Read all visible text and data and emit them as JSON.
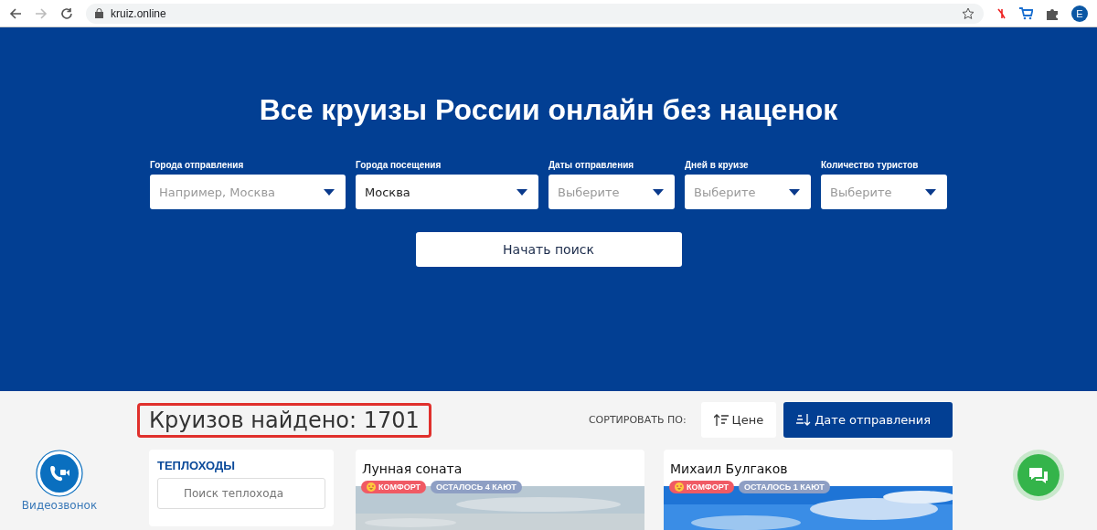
{
  "browser": {
    "url": "kruiz.online",
    "avatar": "E"
  },
  "hero": {
    "title": "Все круизы России онлайн без наценок",
    "filters": [
      {
        "label": "Города отправления",
        "placeholder": "Например, Москва"
      },
      {
        "label": "Города посещения",
        "value": "Москва"
      },
      {
        "label": "Даты отправления",
        "placeholder": "Выберите"
      },
      {
        "label": "Дней в круизе",
        "placeholder": "Выберите"
      },
      {
        "label": "Количество туристов",
        "placeholder": "Выберите"
      }
    ],
    "search_button": "Начать поиск"
  },
  "results": {
    "heading": "Круизов найдено: 1701",
    "highlighted": true,
    "sort_label": "СОРТИРОВАТЬ ПО:",
    "sort_options": [
      {
        "label": "Цене",
        "kind": "asc",
        "selected": false
      },
      {
        "label": "Дате отправления",
        "kind": "desc",
        "selected": true
      }
    ]
  },
  "video_call": {
    "label": "Видеозвонок"
  },
  "sidebar": {
    "title": "ТЕПЛОХОДЫ",
    "search_placeholder": "Поиск теплохода"
  },
  "cards": [
    {
      "title": "Лунная соната",
      "badges": [
        {
          "label": "КОМФОРТ",
          "kind": "class"
        },
        {
          "label": "ОСТАЛОСЬ 4 КАЮТ",
          "kind": "cabins"
        }
      ],
      "kind": "picture"
    },
    {
      "title": "Михаил Булгаков",
      "badges": [
        {
          "label": "КОМФОРТ",
          "kind": "class"
        },
        {
          "label": "ОСТАЛОСЬ 1 КАЮТ",
          "kind": "cabins"
        }
      ],
      "kind": "picture"
    }
  ]
}
